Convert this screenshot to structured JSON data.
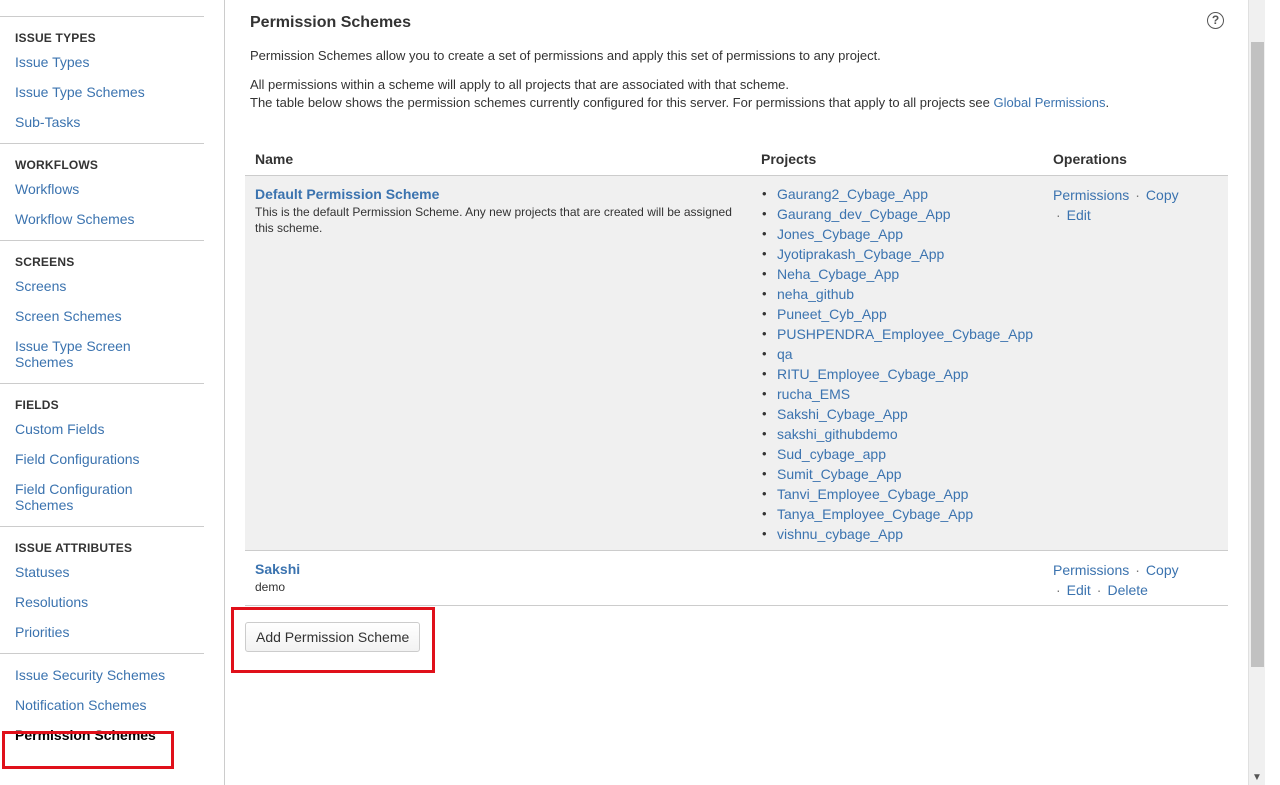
{
  "sidebar": {
    "sections": [
      {
        "heading": "ISSUE TYPES",
        "items": [
          "Issue Types",
          "Issue Type Schemes",
          "Sub-Tasks"
        ]
      },
      {
        "heading": "WORKFLOWS",
        "items": [
          "Workflows",
          "Workflow Schemes"
        ]
      },
      {
        "heading": "SCREENS",
        "items": [
          "Screens",
          "Screen Schemes",
          "Issue Type Screen Schemes"
        ]
      },
      {
        "heading": "FIELDS",
        "items": [
          "Custom Fields",
          "Field Configurations",
          "Field Configuration Schemes"
        ]
      },
      {
        "heading": "ISSUE ATTRIBUTES",
        "items": [
          "Statuses",
          "Resolutions",
          "Priorities"
        ]
      }
    ],
    "extra_items": [
      "Issue Security Schemes",
      "Notification Schemes",
      "Permission Schemes"
    ],
    "active_item": "Permission Schemes"
  },
  "page": {
    "title": "Permission Schemes",
    "help_icon": "?",
    "description_1": "Permission Schemes allow you to create a set of permissions and apply this set of permissions to any project.",
    "description_2": "All permissions within a scheme will apply to all projects that are associated with that scheme.",
    "description_3": "The table below shows the permission schemes currently configured for this server. For permissions that apply to all projects see ",
    "global_permissions_link": "Global Permissions",
    "description_3_end": "."
  },
  "table": {
    "headers": {
      "name": "Name",
      "projects": "Projects",
      "operations": "Operations"
    },
    "rows": [
      {
        "name": "Default Permission Scheme",
        "description": "This is the default Permission Scheme. Any new projects that are created will be assigned this scheme.",
        "projects": [
          "Gaurang2_Cybage_App",
          "Gaurang_dev_Cybage_App",
          "Jones_Cybage_App",
          "Jyotiprakash_Cybage_App",
          "Neha_Cybage_App",
          "neha_github",
          "Puneet_Cyb_App",
          "PUSHPENDRA_Employee_Cybage_App",
          "qa",
          "RITU_Employee_Cybage_App",
          "rucha_EMS",
          "Sakshi_Cybage_App",
          "sakshi_githubdemo",
          "Sud_cybage_app",
          "Sumit_Cybage_App",
          "Tanvi_Employee_Cybage_App",
          "Tanya_Employee_Cybage_App",
          "vishnu_cybage_App"
        ],
        "ops": {
          "permissions": "Permissions",
          "copy": "Copy",
          "edit": "Edit"
        }
      },
      {
        "name": "Sakshi",
        "description": "demo",
        "projects": [],
        "ops": {
          "permissions": "Permissions",
          "copy": "Copy",
          "edit": "Edit",
          "delete": "Delete"
        }
      }
    ],
    "separator": "·"
  },
  "add_button_label": "Add Permission Scheme",
  "colors": {
    "link": "#3b73af",
    "highlight": "#e0101a",
    "row_bg": "#f0f0f0"
  }
}
